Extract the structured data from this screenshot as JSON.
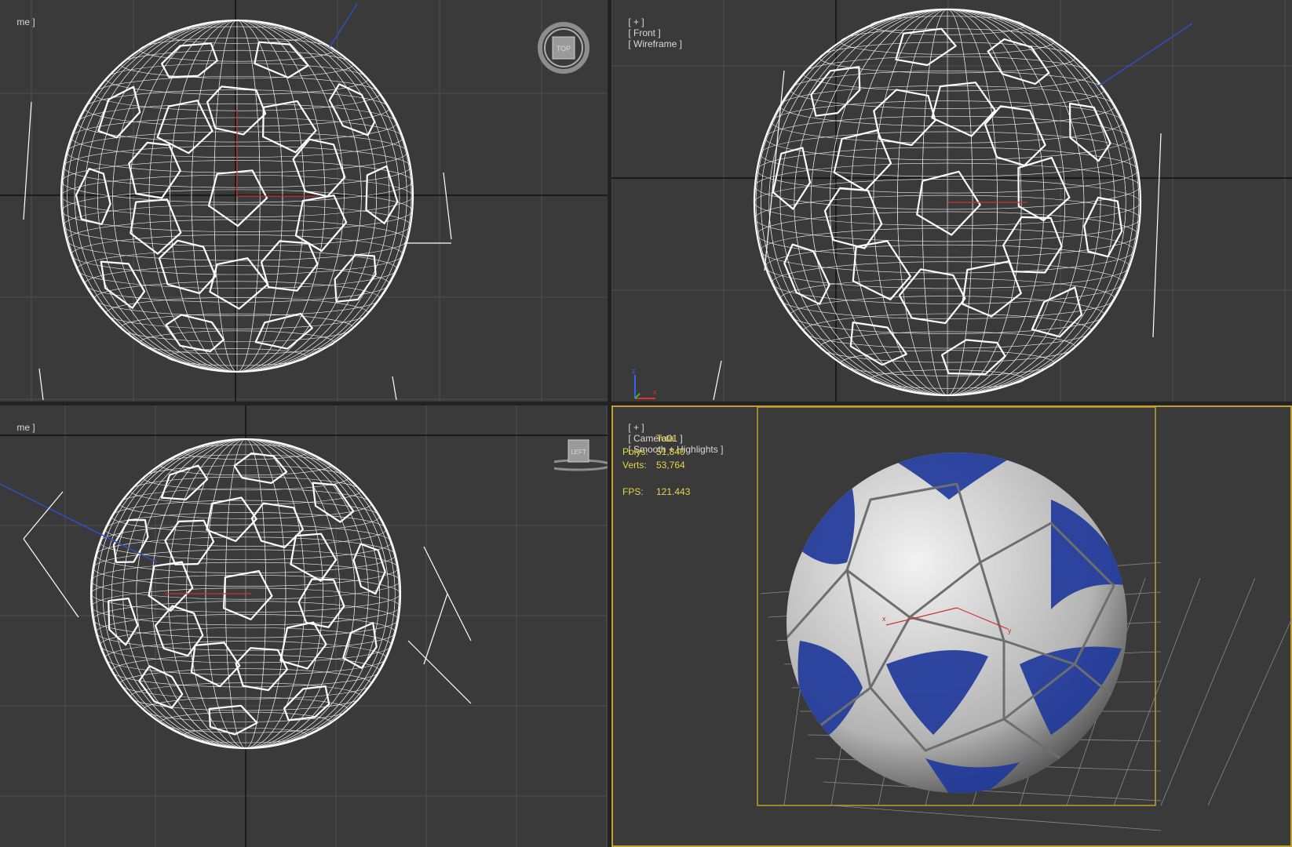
{
  "viewports": {
    "top": {
      "label_tail": "me ]",
      "viewcube_label": "TOP"
    },
    "front": {
      "label": [
        "[ + ]",
        "[ Front ]",
        "[ Wireframe ]"
      ]
    },
    "left": {
      "label_tail": "me ]",
      "viewcube_label": "LEFT"
    },
    "camera": {
      "label": [
        "[ + ]",
        "[ Camera01 ]",
        "[ Smooth + Highlights ]"
      ],
      "stats": {
        "header": "Total",
        "polys_label": "Polys:",
        "polys_value": "51,840",
        "verts_label": "Verts:",
        "verts_value": "53,764",
        "fps_label": "FPS:",
        "fps_value": "121.443"
      }
    }
  },
  "axis_tripod": {
    "z": "z",
    "x": "x"
  },
  "gizmo_labels": {
    "x": "x",
    "y": "y"
  },
  "colors": {
    "viewport_bg": "#3a3a3a",
    "grid": "#505050",
    "grid_axis": "#111111",
    "wire": "#ffffff",
    "active_border": "#c2a02a",
    "stats_text": "#e8d44a",
    "ball_blue": "#1f3a9a",
    "ball_white": "#cfcfcf"
  }
}
